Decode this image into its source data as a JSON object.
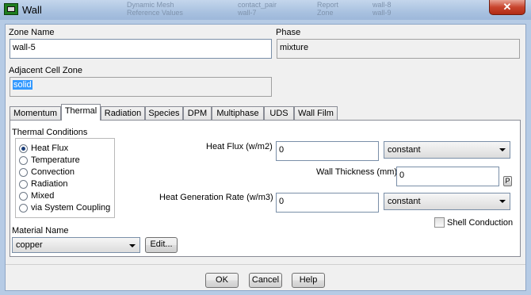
{
  "window": {
    "title": "Wall",
    "close_glyph": "✕",
    "background_text": [
      "Dynamic Mesh",
      "Reference Values",
      "Report",
      "Zone",
      "contact_pair",
      "wall-7",
      "wall-8",
      "wall-9"
    ]
  },
  "zone_name": {
    "label": "Zone Name",
    "value": "wall-5"
  },
  "phase": {
    "label": "Phase",
    "value": "mixture"
  },
  "adjacent_cell_zone": {
    "label": "Adjacent Cell Zone",
    "value": "solid"
  },
  "tabs": [
    {
      "label": "Momentum"
    },
    {
      "label": "Thermal",
      "active": true
    },
    {
      "label": "Radiation"
    },
    {
      "label": "Species"
    },
    {
      "label": "DPM"
    },
    {
      "label": "Multiphase"
    },
    {
      "label": "UDS"
    },
    {
      "label": "Wall Film"
    }
  ],
  "thermal": {
    "conditions_label": "Thermal Conditions",
    "options": [
      {
        "label": "Heat Flux",
        "selected": true
      },
      {
        "label": "Temperature",
        "selected": false
      },
      {
        "label": "Convection",
        "selected": false
      },
      {
        "label": "Radiation",
        "selected": false
      },
      {
        "label": "Mixed",
        "selected": false
      },
      {
        "label": "via System Coupling",
        "selected": false
      }
    ],
    "heat_flux": {
      "label": "Heat Flux (w/m2)",
      "value": "0",
      "method": "constant"
    },
    "wall_thickness": {
      "label": "Wall Thickness (mm)",
      "value": "0",
      "param_button": "P"
    },
    "heat_generation": {
      "label": "Heat Generation Rate (w/m3)",
      "value": "0",
      "method": "constant"
    },
    "shell_conduction": {
      "label": "Shell Conduction",
      "checked": false
    },
    "material": {
      "label": "Material Name",
      "value": "copper",
      "edit_label": "Edit..."
    }
  },
  "footer": {
    "ok": "OK",
    "cancel": "Cancel",
    "help": "Help"
  }
}
